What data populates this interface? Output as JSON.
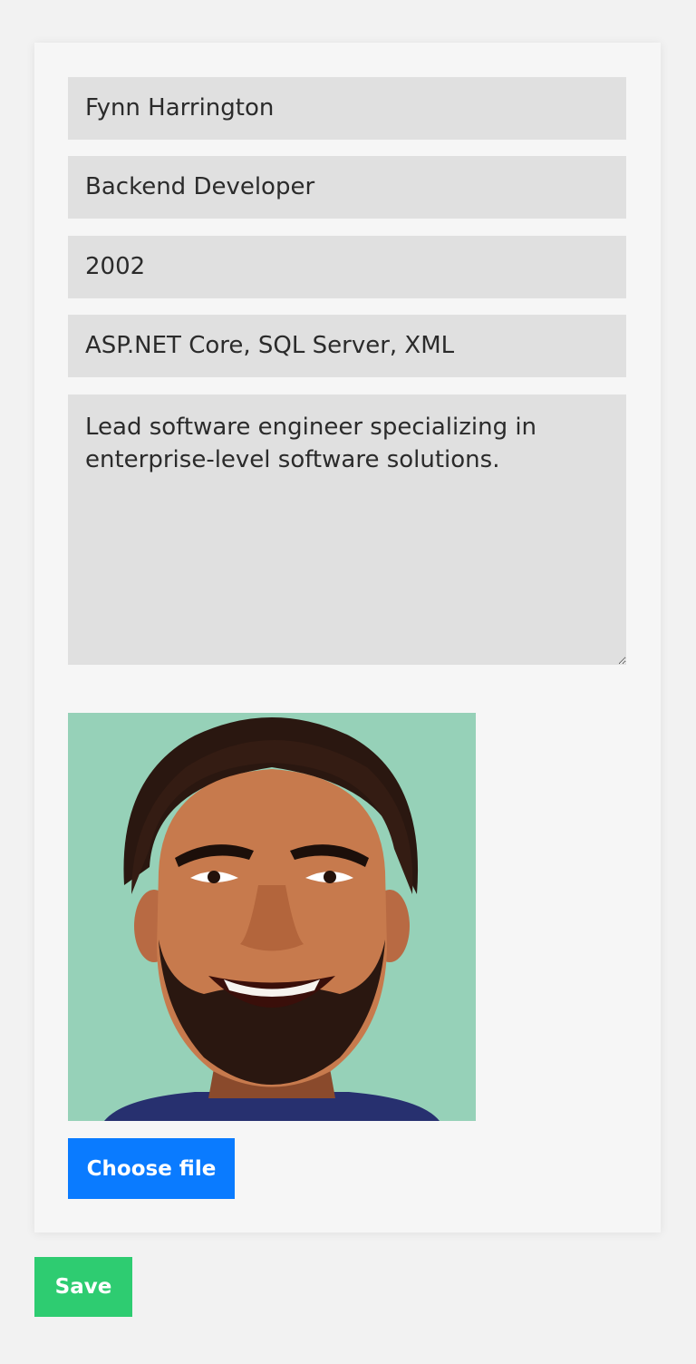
{
  "profile_form": {
    "name": "Fynn Harrington",
    "role": "Backend Developer",
    "year": "2002",
    "skills": "ASP.NET Core, SQL Server, XML",
    "bio": "Lead software engineer specializing in\nenterprise-level software solutions."
  },
  "avatar": {
    "icon": "person-avatar-icon",
    "background_color": "#96d1b8"
  },
  "buttons": {
    "choose_file_label": "Choose file",
    "save_label": "Save"
  },
  "colors": {
    "choose_button": "#0a7bff",
    "save_button": "#2ecc71"
  }
}
